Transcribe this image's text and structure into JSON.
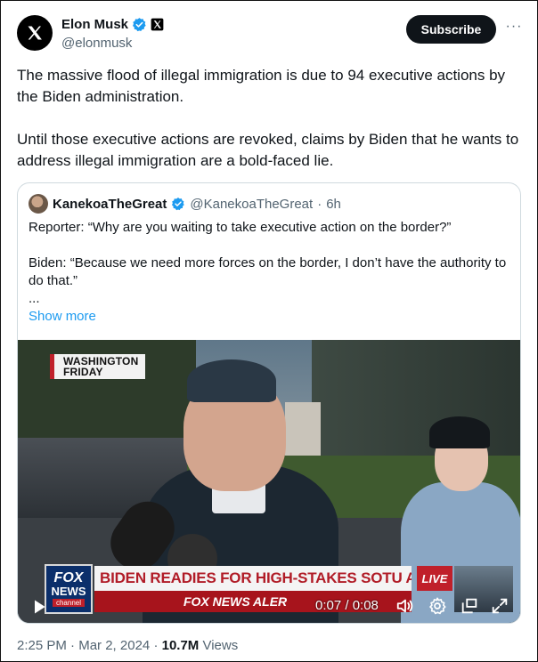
{
  "author": {
    "display_name": "Elon Musk",
    "handle": "@elonmusk",
    "avatar_icon": "x-logo-icon",
    "verified_color": "#1d9bf0"
  },
  "actions": {
    "subscribe_label": "Subscribe",
    "more_label": "···"
  },
  "tweet": {
    "paragraphs": [
      "The massive flood of illegal immigration is due to 94 executive actions by the Biden administration.",
      "Until those executive actions are revoked, claims by Biden that he wants to address illegal immigration are a bold-faced lie."
    ]
  },
  "quote": {
    "display_name": "KanekoaTheGreat",
    "handle": "@KanekoaTheGreat",
    "separator": "·",
    "time": "6h",
    "lines": [
      "Reporter: “Why are you waiting to take executive action on the border?”",
      "Biden: “Because we need more forces on the border, I don’t have the authority to do that.”",
      "..."
    ],
    "show_more": "Show more"
  },
  "video": {
    "badge_line1": "WASHINGTON",
    "badge_line2": "FRIDAY",
    "logo_line1": "FOX",
    "logo_line2": "NEWS",
    "logo_line3": "channel",
    "headline": "BIDEN READIES FOR HIGH-STAKES SOTU AMID LOW POLLS",
    "ticker": "FOX NEWS ALER",
    "live_label": "LIVE",
    "timecode": "0:07 / 0:08"
  },
  "meta": {
    "time": "2:25 PM",
    "separator": "·",
    "date": "Mar 2, 2024",
    "views_count": "10.7M",
    "views_label": "Views"
  }
}
